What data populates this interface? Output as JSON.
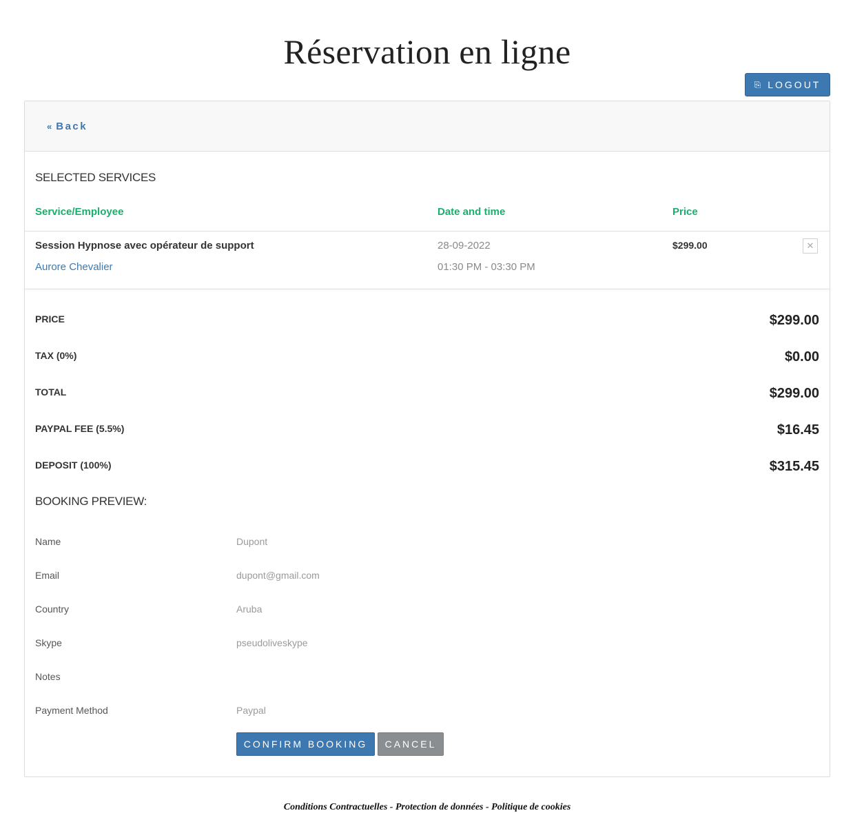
{
  "page": {
    "title": "Réservation en ligne"
  },
  "header": {
    "logout_label": "LOGOUT",
    "logout_icon": "sign-out-icon"
  },
  "card": {
    "back_label": "Back",
    "back_icon": "double-chevron-left-icon"
  },
  "services": {
    "title": "SELECTED SERVICES",
    "columns": [
      "Service/Employee",
      "Date and time",
      "Price"
    ],
    "rows": [
      {
        "service": "Session Hypnose avec opérateur de support",
        "employee": "Aurore Chevalier",
        "date": "28-09-2022",
        "time": "01:30 PM - 03:30 PM",
        "price": "$299.00"
      }
    ]
  },
  "summary": {
    "items": [
      {
        "label": "PRICE",
        "value": "$299.00"
      },
      {
        "label": "TAX (0%)",
        "value": "$0.00"
      },
      {
        "label": "TOTAL",
        "value": "$299.00"
      },
      {
        "label": "PAYPAL FEE (5.5%)",
        "value": "$16.45"
      },
      {
        "label": "DEPOSIT (100%)",
        "value": "$315.45"
      }
    ]
  },
  "preview": {
    "title": "BOOKING PREVIEW:",
    "fields": [
      {
        "label": "Name",
        "value": "Dupont"
      },
      {
        "label": "Email",
        "value": "dupont@gmail.com"
      },
      {
        "label": "Country",
        "value": "Aruba"
      },
      {
        "label": "Skype",
        "value": "pseudoliveskype"
      },
      {
        "label": "Notes",
        "value": ""
      },
      {
        "label": "Payment Method",
        "value": "Paypal"
      }
    ]
  },
  "actions": {
    "confirm_label": "CONFIRM BOOKING",
    "cancel_label": "CANCEL"
  },
  "footer": {
    "links": [
      "Conditions Contractuelles",
      "Protection de données",
      "Politique de cookies"
    ],
    "separator": " - "
  },
  "colors": {
    "accent_blue": "#3e78b0",
    "header_green": "#1aaf6c",
    "cancel_gray": "#8b8e91"
  }
}
